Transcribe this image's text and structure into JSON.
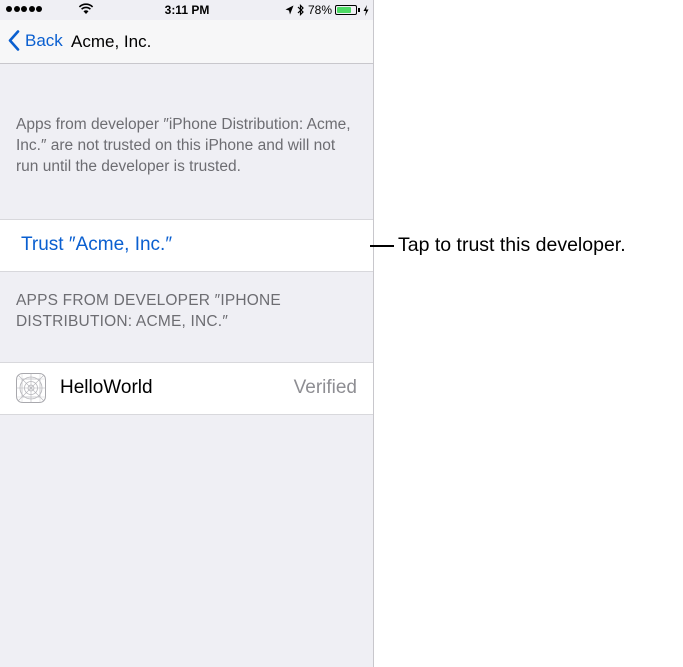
{
  "status_bar": {
    "time": "3:11 PM",
    "battery_percent": "78%",
    "battery_level": 0.78,
    "signal_bars": 5
  },
  "nav": {
    "back_label": "Back",
    "title": "Acme, Inc."
  },
  "info_text": "Apps from developer ″iPhone Distribution: Acme, Inc.″ are not trusted on this iPhone and will not run until the developer is trusted.",
  "trust_action": {
    "label": "Trust ″Acme, Inc.″"
  },
  "apps_section": {
    "header": "APPS FROM DEVELOPER ″IPHONE DISTRIBUTION: ACME, INC.″",
    "apps": [
      {
        "name": "HelloWorld",
        "status": "Verified",
        "icon": "app-placeholder-icon"
      }
    ]
  },
  "callout": {
    "text": "Tap to trust this developer."
  },
  "colors": {
    "accent": "#0a5fd0",
    "background": "#efeff4",
    "secondary_text": "#6d6d72",
    "battery": "#4cd964"
  }
}
